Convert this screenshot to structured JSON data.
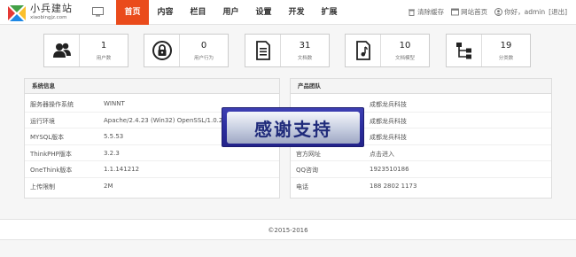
{
  "brand": {
    "name": "小兵建站",
    "domain": "xiaobingjz.com",
    "accent": "#ea4b1b"
  },
  "nav": [
    {
      "label": "首页",
      "active": true
    },
    {
      "label": "内容",
      "active": false
    },
    {
      "label": "栏目",
      "active": false
    },
    {
      "label": "用户",
      "active": false
    },
    {
      "label": "设置",
      "active": false
    },
    {
      "label": "开发",
      "active": false
    },
    {
      "label": "扩展",
      "active": false
    }
  ],
  "toolbar": {
    "clear_cache": "清除缓存",
    "site_home": "网站首页",
    "user_prefix": "你好，",
    "username": "admin",
    "logout": "[退出]"
  },
  "stats": [
    {
      "icon": "users-icon",
      "value": "1",
      "label": "用户数"
    },
    {
      "icon": "lock-icon",
      "value": "0",
      "label": "用户行为"
    },
    {
      "icon": "document-icon",
      "value": "31",
      "label": "文档数"
    },
    {
      "icon": "document-model-icon",
      "value": "10",
      "label": "文档模型"
    },
    {
      "icon": "category-tree-icon",
      "value": "19",
      "label": "分类数"
    }
  ],
  "system_panel": {
    "title": "系统信息",
    "rows": [
      {
        "key": "服务器操作系统",
        "value": "WINNT"
      },
      {
        "key": "运行环境",
        "value": "Apache/2.4.23 (Win32) OpenSSL/1.0.2j PHP/5.5.38"
      },
      {
        "key": "MYSQL版本",
        "value": "5.5.53"
      },
      {
        "key": "ThinkPHP版本",
        "value": "3.2.3"
      },
      {
        "key": "OneThink版本",
        "value": "1.1.141212"
      },
      {
        "key": "上传限制",
        "value": "2M"
      }
    ]
  },
  "team_panel": {
    "title": "产品团队",
    "rows": [
      {
        "key": "",
        "value": "成都龙兵科技"
      },
      {
        "key": "",
        "value": "成都龙兵科技"
      },
      {
        "key": "",
        "value": "成都龙兵科技"
      },
      {
        "key": "官方网址",
        "value": "点击进入"
      },
      {
        "key": "QQ咨询",
        "value": "1923510186"
      },
      {
        "key": "电话",
        "value": "188 2802 1173"
      }
    ]
  },
  "banner": {
    "text": "感谢支持"
  },
  "footer": {
    "text": "©2015-2016"
  }
}
